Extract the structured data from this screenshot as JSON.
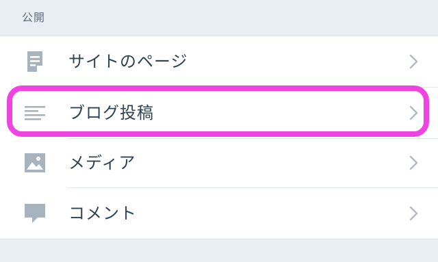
{
  "section": {
    "title": "公開"
  },
  "items": [
    {
      "label": "サイトのページ",
      "icon": "page-icon"
    },
    {
      "label": "ブログ投稿",
      "icon": "posts-icon"
    },
    {
      "label": "メディア",
      "icon": "image-icon"
    },
    {
      "label": "コメント",
      "icon": "comment-icon"
    }
  ],
  "colors": {
    "background": "#e9eef3",
    "row_background": "#ffffff",
    "text": "#2e4453",
    "icon": "#a7b3bf",
    "chevron": "#b0bac3",
    "highlight": "#ee44e2"
  }
}
